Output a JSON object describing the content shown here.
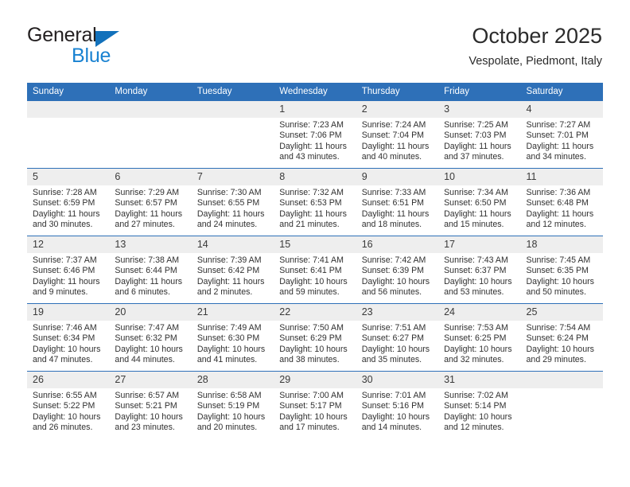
{
  "brand": {
    "name_top": "General",
    "name_bottom": "Blue",
    "accent_color": "#1982d1",
    "triangle_color": "#1271bb"
  },
  "header": {
    "title": "October 2025",
    "subtitle": "Vespolate, Piedmont, Italy"
  },
  "calendar": {
    "header_bg": "#2e70b8",
    "daynum_bg": "#eeeeee",
    "weekdays": [
      "Sunday",
      "Monday",
      "Tuesday",
      "Wednesday",
      "Thursday",
      "Friday",
      "Saturday"
    ],
    "weeks": [
      [
        {
          "day": "",
          "empty": true
        },
        {
          "day": "",
          "empty": true
        },
        {
          "day": "",
          "empty": true
        },
        {
          "day": "1",
          "sunrise": "Sunrise: 7:23 AM",
          "sunset": "Sunset: 7:06 PM",
          "daylight": "Daylight: 11 hours and 43 minutes."
        },
        {
          "day": "2",
          "sunrise": "Sunrise: 7:24 AM",
          "sunset": "Sunset: 7:04 PM",
          "daylight": "Daylight: 11 hours and 40 minutes."
        },
        {
          "day": "3",
          "sunrise": "Sunrise: 7:25 AM",
          "sunset": "Sunset: 7:03 PM",
          "daylight": "Daylight: 11 hours and 37 minutes."
        },
        {
          "day": "4",
          "sunrise": "Sunrise: 7:27 AM",
          "sunset": "Sunset: 7:01 PM",
          "daylight": "Daylight: 11 hours and 34 minutes."
        }
      ],
      [
        {
          "day": "5",
          "sunrise": "Sunrise: 7:28 AM",
          "sunset": "Sunset: 6:59 PM",
          "daylight": "Daylight: 11 hours and 30 minutes."
        },
        {
          "day": "6",
          "sunrise": "Sunrise: 7:29 AM",
          "sunset": "Sunset: 6:57 PM",
          "daylight": "Daylight: 11 hours and 27 minutes."
        },
        {
          "day": "7",
          "sunrise": "Sunrise: 7:30 AM",
          "sunset": "Sunset: 6:55 PM",
          "daylight": "Daylight: 11 hours and 24 minutes."
        },
        {
          "day": "8",
          "sunrise": "Sunrise: 7:32 AM",
          "sunset": "Sunset: 6:53 PM",
          "daylight": "Daylight: 11 hours and 21 minutes."
        },
        {
          "day": "9",
          "sunrise": "Sunrise: 7:33 AM",
          "sunset": "Sunset: 6:51 PM",
          "daylight": "Daylight: 11 hours and 18 minutes."
        },
        {
          "day": "10",
          "sunrise": "Sunrise: 7:34 AM",
          "sunset": "Sunset: 6:50 PM",
          "daylight": "Daylight: 11 hours and 15 minutes."
        },
        {
          "day": "11",
          "sunrise": "Sunrise: 7:36 AM",
          "sunset": "Sunset: 6:48 PM",
          "daylight": "Daylight: 11 hours and 12 minutes."
        }
      ],
      [
        {
          "day": "12",
          "sunrise": "Sunrise: 7:37 AM",
          "sunset": "Sunset: 6:46 PM",
          "daylight": "Daylight: 11 hours and 9 minutes."
        },
        {
          "day": "13",
          "sunrise": "Sunrise: 7:38 AM",
          "sunset": "Sunset: 6:44 PM",
          "daylight": "Daylight: 11 hours and 6 minutes."
        },
        {
          "day": "14",
          "sunrise": "Sunrise: 7:39 AM",
          "sunset": "Sunset: 6:42 PM",
          "daylight": "Daylight: 11 hours and 2 minutes."
        },
        {
          "day": "15",
          "sunrise": "Sunrise: 7:41 AM",
          "sunset": "Sunset: 6:41 PM",
          "daylight": "Daylight: 10 hours and 59 minutes."
        },
        {
          "day": "16",
          "sunrise": "Sunrise: 7:42 AM",
          "sunset": "Sunset: 6:39 PM",
          "daylight": "Daylight: 10 hours and 56 minutes."
        },
        {
          "day": "17",
          "sunrise": "Sunrise: 7:43 AM",
          "sunset": "Sunset: 6:37 PM",
          "daylight": "Daylight: 10 hours and 53 minutes."
        },
        {
          "day": "18",
          "sunrise": "Sunrise: 7:45 AM",
          "sunset": "Sunset: 6:35 PM",
          "daylight": "Daylight: 10 hours and 50 minutes."
        }
      ],
      [
        {
          "day": "19",
          "sunrise": "Sunrise: 7:46 AM",
          "sunset": "Sunset: 6:34 PM",
          "daylight": "Daylight: 10 hours and 47 minutes."
        },
        {
          "day": "20",
          "sunrise": "Sunrise: 7:47 AM",
          "sunset": "Sunset: 6:32 PM",
          "daylight": "Daylight: 10 hours and 44 minutes."
        },
        {
          "day": "21",
          "sunrise": "Sunrise: 7:49 AM",
          "sunset": "Sunset: 6:30 PM",
          "daylight": "Daylight: 10 hours and 41 minutes."
        },
        {
          "day": "22",
          "sunrise": "Sunrise: 7:50 AM",
          "sunset": "Sunset: 6:29 PM",
          "daylight": "Daylight: 10 hours and 38 minutes."
        },
        {
          "day": "23",
          "sunrise": "Sunrise: 7:51 AM",
          "sunset": "Sunset: 6:27 PM",
          "daylight": "Daylight: 10 hours and 35 minutes."
        },
        {
          "day": "24",
          "sunrise": "Sunrise: 7:53 AM",
          "sunset": "Sunset: 6:25 PM",
          "daylight": "Daylight: 10 hours and 32 minutes."
        },
        {
          "day": "25",
          "sunrise": "Sunrise: 7:54 AM",
          "sunset": "Sunset: 6:24 PM",
          "daylight": "Daylight: 10 hours and 29 minutes."
        }
      ],
      [
        {
          "day": "26",
          "sunrise": "Sunrise: 6:55 AM",
          "sunset": "Sunset: 5:22 PM",
          "daylight": "Daylight: 10 hours and 26 minutes."
        },
        {
          "day": "27",
          "sunrise": "Sunrise: 6:57 AM",
          "sunset": "Sunset: 5:21 PM",
          "daylight": "Daylight: 10 hours and 23 minutes."
        },
        {
          "day": "28",
          "sunrise": "Sunrise: 6:58 AM",
          "sunset": "Sunset: 5:19 PM",
          "daylight": "Daylight: 10 hours and 20 minutes."
        },
        {
          "day": "29",
          "sunrise": "Sunrise: 7:00 AM",
          "sunset": "Sunset: 5:17 PM",
          "daylight": "Daylight: 10 hours and 17 minutes."
        },
        {
          "day": "30",
          "sunrise": "Sunrise: 7:01 AM",
          "sunset": "Sunset: 5:16 PM",
          "daylight": "Daylight: 10 hours and 14 minutes."
        },
        {
          "day": "31",
          "sunrise": "Sunrise: 7:02 AM",
          "sunset": "Sunset: 5:14 PM",
          "daylight": "Daylight: 10 hours and 12 minutes."
        },
        {
          "day": "",
          "empty": true
        }
      ]
    ]
  }
}
